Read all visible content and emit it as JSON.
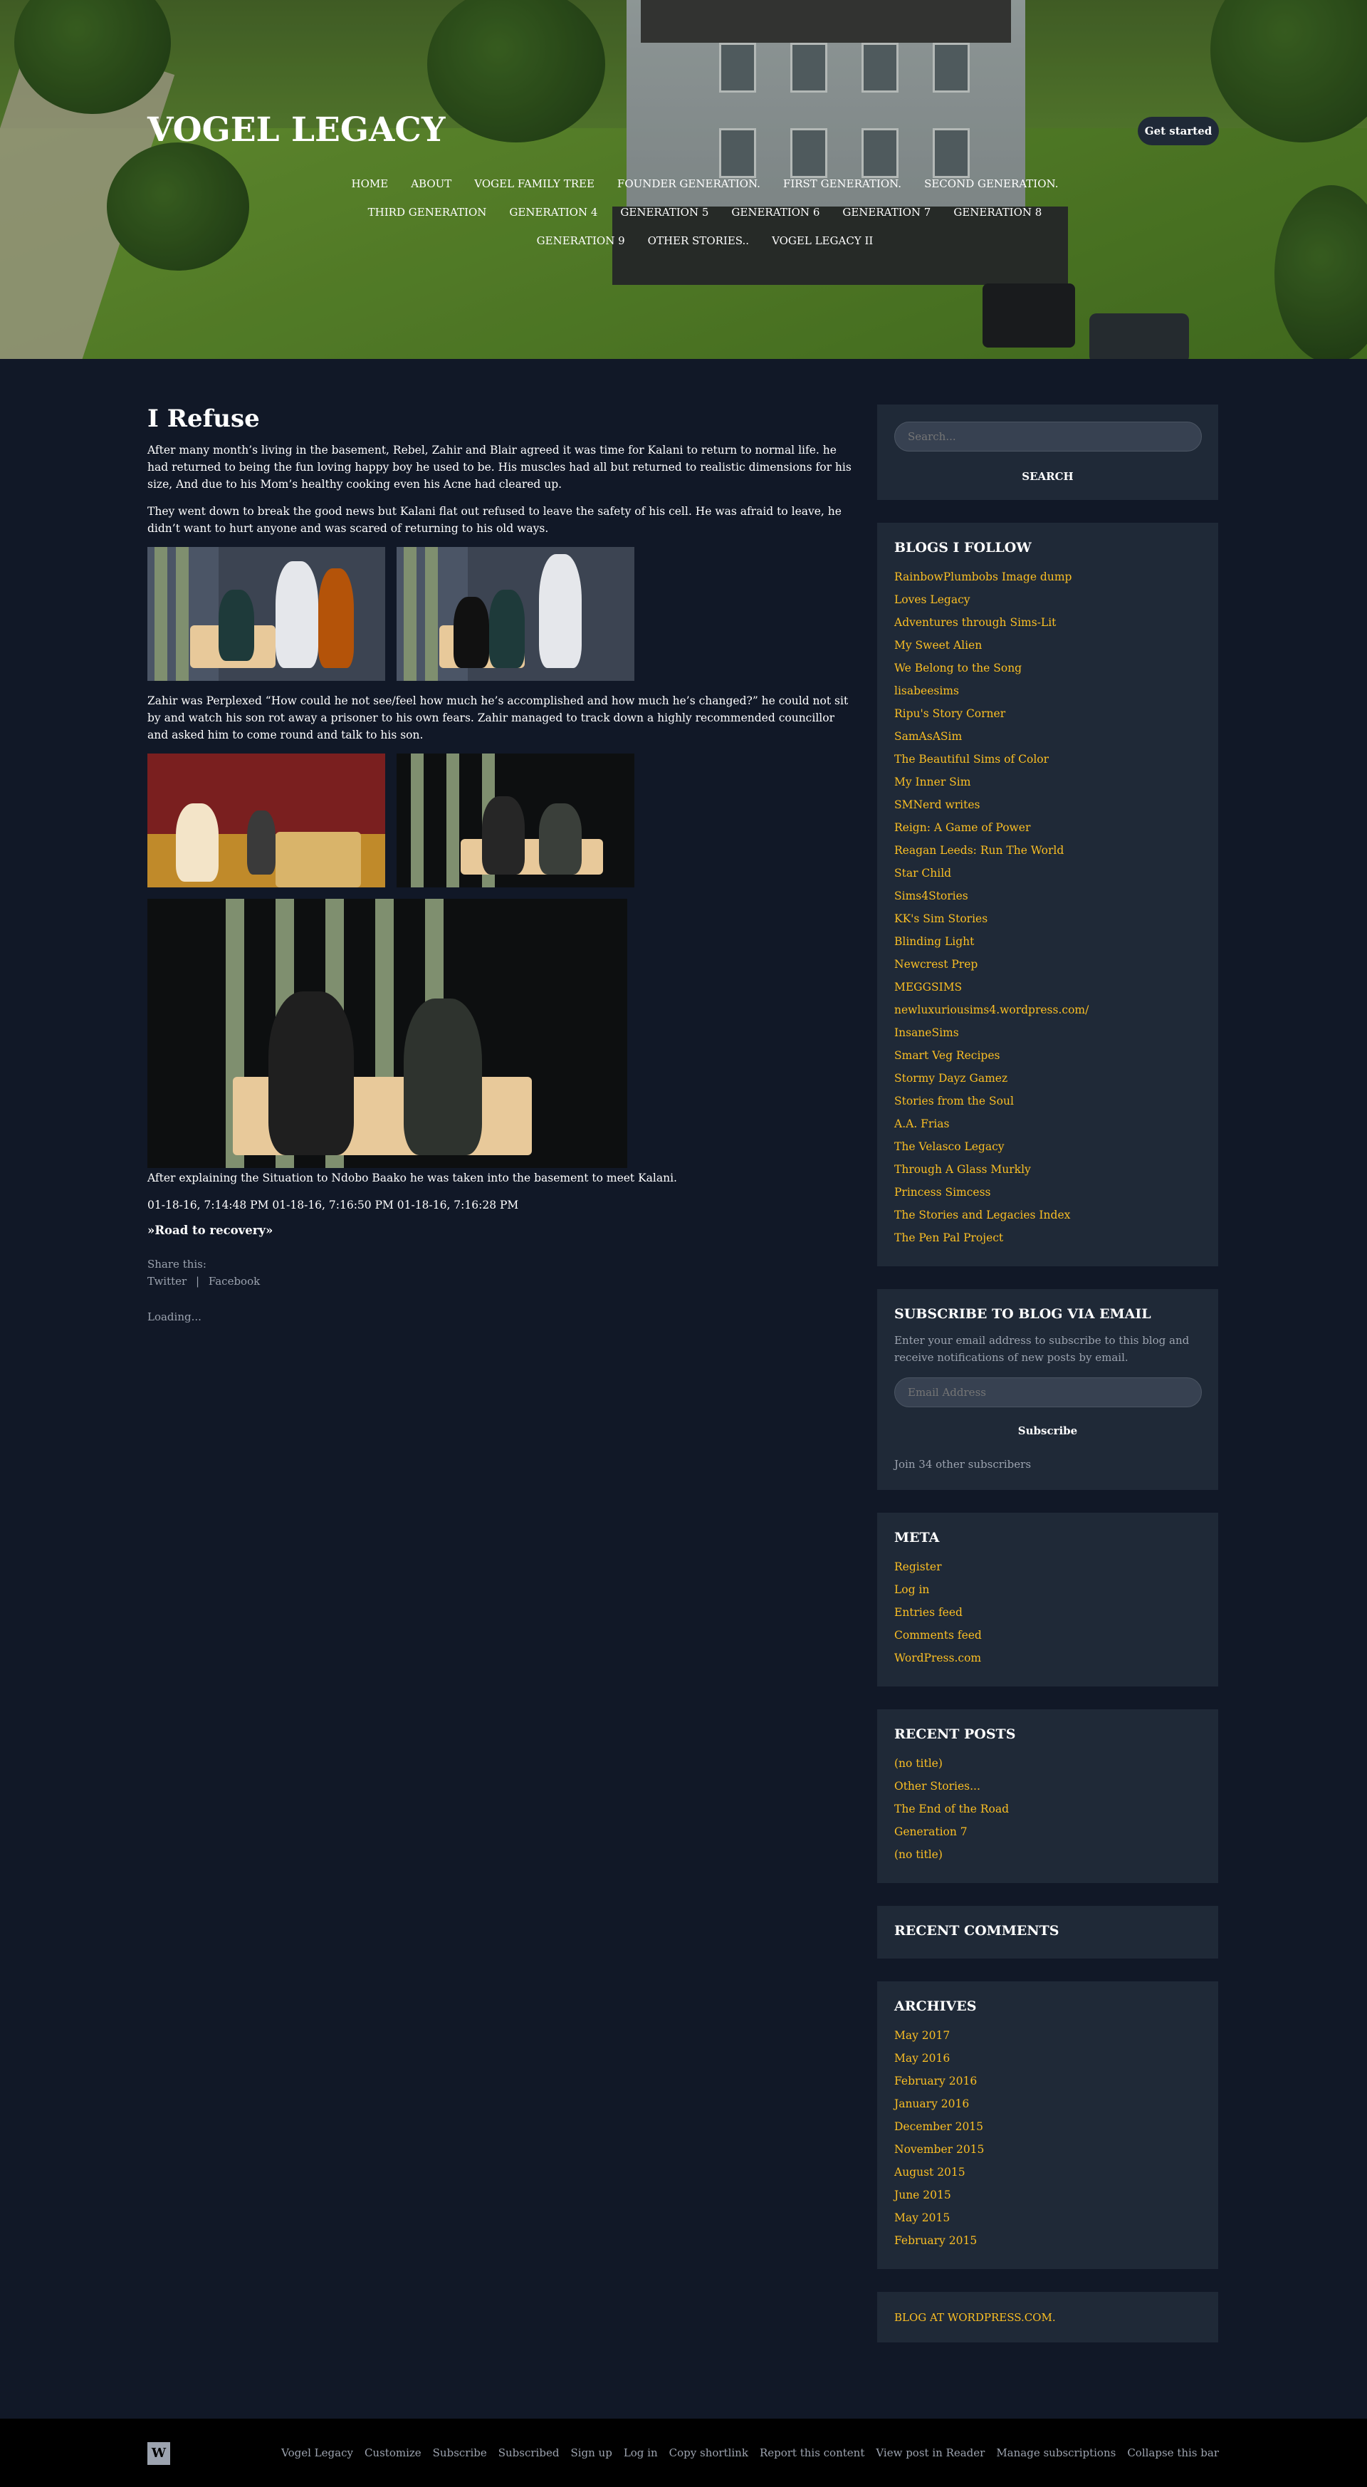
{
  "site": {
    "title": "VOGEL LEGACY",
    "cta_label": "Get started"
  },
  "nav": {
    "row1": [
      "HOME",
      "ABOUT",
      "VOGEL FAMILY TREE",
      "FOUNDER GENERATION.",
      "FIRST GENERATION.",
      "SECOND GENERATION."
    ],
    "row2": [
      "THIRD GENERATION",
      "GENERATION 4",
      "GENERATION 5",
      "GENERATION 6",
      "GENERATION 7",
      "GENERATION 8"
    ],
    "row3": [
      "GENERATION 9",
      "OTHER STORIES..",
      "VOGEL LEGACY II"
    ]
  },
  "post": {
    "title": "I Refuse",
    "p1": "After many month’s living in the basement, Rebel, Zahir and Blair agreed it was time for Kalani to return to normal life. he had returned to being the fun loving happy boy he used to be. His muscles had all but returned to realistic dimensions for his size, And due to his Mom’s healthy cooking even his Acne had cleared up.",
    "p2": "They went down to break the good news but Kalani flat out refused to leave the safety of his cell. He was afraid to leave, he didn’t want to hurt anyone and was scared of returning to his old ways.",
    "p3": "Zahir was Perplexed “How could he not see/feel how much he’s accomplished and how much he’s changed?” he could not sit by and watch his son rot away a prisoner to his own fears. Zahir managed to track down a highly recommended councillor and asked him to come round and talk to his son.",
    "p4": "After explaining the Situation to Ndobo Baako he was taken into the basement to meet Kalani.",
    "timestamps": "01-18-16, 7:14:48 PM 01-18-16, 7:16:50 PM 01-18-16, 7:16:28 PM",
    "next_link": "»Road to recovery»",
    "share_label": "Share this:",
    "share_twitter": "Twitter",
    "share_sep": "|",
    "share_facebook": "Facebook",
    "loading": "Loading..."
  },
  "sidebar": {
    "search_placeholder": "Search...",
    "search_button": "SEARCH",
    "blogs_title": "BLOGS I FOLLOW",
    "blogs": [
      "RainbowPlumbobs Image dump",
      "Loves Legacy",
      "Adventures through Sims-Lit",
      "My Sweet Alien",
      "We Belong to the Song",
      "lisabeesims",
      "Ripu's Story Corner",
      "SamAsASim",
      "The Beautiful Sims of Color",
      "My Inner Sim",
      "SMNerd writes",
      "Reign: A Game of Power",
      "Reagan Leeds: Run The World",
      "Star Child",
      "Sims4Stories",
      "KK's Sim Stories",
      "Blinding Light",
      "Newcrest Prep",
      "MEGGSIMS",
      "newluxuriousims4.wordpress.com/",
      "InsaneSims",
      "Smart Veg Recipes",
      "Stormy Dayz Gamez",
      "Stories from the Soul",
      "A.A. Frias",
      "The Velasco Legacy",
      "Through A Glass Murkly",
      "Princess Simcess",
      "The Stories and Legacies Index",
      "The Pen Pal Project"
    ],
    "subscribe_title": "SUBSCRIBE TO BLOG VIA EMAIL",
    "subscribe_text": "Enter your email address to subscribe to this blog and receive notifications of new posts by email.",
    "email_placeholder": "Email Address",
    "subscribe_button": "Subscribe",
    "subscribers": "Join 34 other subscribers",
    "meta_title": "META",
    "meta": [
      "Register",
      "Log in",
      "Entries feed",
      "Comments feed",
      "WordPress.com"
    ],
    "recent_posts_title": "RECENT POSTS",
    "recent_posts": [
      "(no title)",
      "Other Stories...",
      "The End of the Road",
      "Generation 7",
      "(no title)"
    ],
    "recent_comments_title": "RECENT COMMENTS",
    "archives_title": "ARCHIVES",
    "archives": [
      "May 2017",
      "May 2016",
      "February 2016",
      "January 2016",
      "December 2015",
      "November 2015",
      "August 2015",
      "June 2015",
      "May 2015",
      "February 2015"
    ],
    "footer_credit": "BLOG AT WORDPRESS.COM."
  },
  "bottombar": {
    "logo": "W",
    "links": [
      "Vogel Legacy",
      "Customize",
      "Subscribe",
      "Subscribed",
      "Sign up",
      "Log in",
      "Copy shortlink",
      "Report this content",
      "View post in Reader",
      "Manage subscriptions",
      "Collapse this bar"
    ]
  },
  "colors": {
    "background": "#111827",
    "panel": "#1f2937",
    "link": "#fbbf24"
  }
}
